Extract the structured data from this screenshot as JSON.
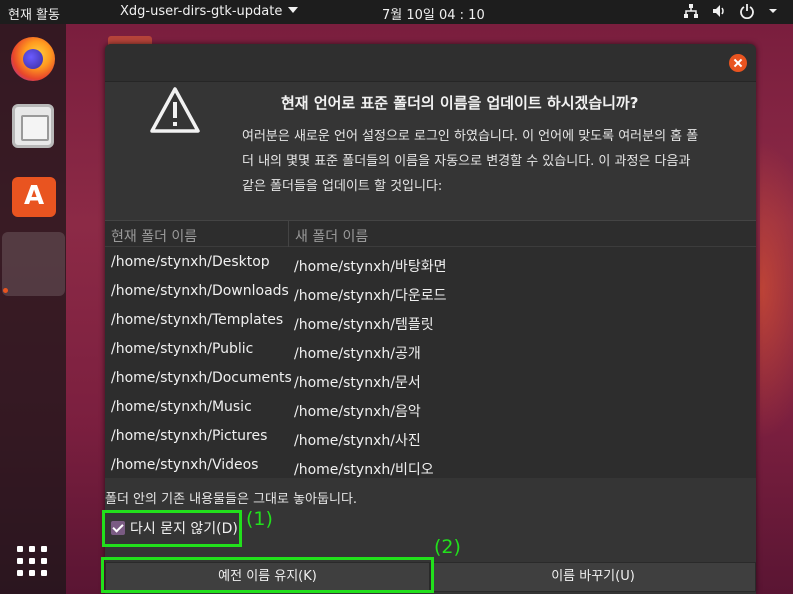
{
  "topbar": {
    "activities": "현재 활동",
    "app_menu": "Xdg-user-dirs-gtk-update",
    "clock": "7월 10일  04 : 10",
    "tray_icons": [
      "network-icon",
      "volume-icon",
      "power-icon",
      "chevron-down-icon"
    ]
  },
  "dock": {
    "items": [
      "firefox-icon",
      "files-icon",
      "software-center-icon",
      "active-app-slot"
    ],
    "software_letter": "A",
    "show_apps": "grid-icon"
  },
  "dialog": {
    "headline": "현재 언어로 표준 폴더의 이름을 업데이트 하시겠습니까?",
    "description": "여러분은 새로운 언어 설정으로 로그인 하였습니다. 이 언어에 맞도록 여러분의 홈 폴\n더 내의 몇몇 표준 폴더들의 이름을 자동으로 변경할 수 있습니다. 이 과정은 다음과\n같은 폴더들을 업데이트 할 것입니다:",
    "table": {
      "headers": [
        "현재 폴더 이름",
        "새 폴더 이름"
      ],
      "rows": [
        [
          "/home/stynxh/Desktop",
          "/home/stynxh/바탕화면"
        ],
        [
          "/home/stynxh/Downloads",
          "/home/stynxh/다운로드"
        ],
        [
          "/home/stynxh/Templates",
          "/home/stynxh/템플릿"
        ],
        [
          "/home/stynxh/Public",
          "/home/stynxh/공개"
        ],
        [
          "/home/stynxh/Documents",
          "/home/stynxh/문서"
        ],
        [
          "/home/stynxh/Music",
          "/home/stynxh/음악"
        ],
        [
          "/home/stynxh/Pictures",
          "/home/stynxh/사진"
        ],
        [
          "/home/stynxh/Videos",
          "/home/stynxh/비디오"
        ]
      ]
    },
    "note": "폴더 안의 기존 내용물들은 그대로 놓아둡니다.",
    "dont_ask_label": "다시 묻지 않기(D)",
    "dont_ask_checked": true,
    "keep_button": "예전 이름 유지(K)",
    "rename_button": "이름 바꾸기(U)"
  },
  "annotations": {
    "label1": "(1)",
    "label2": "(2)",
    "color": "#22e01c"
  },
  "colors": {
    "accent": "#e95420",
    "checkbox": "#7a5b83"
  }
}
